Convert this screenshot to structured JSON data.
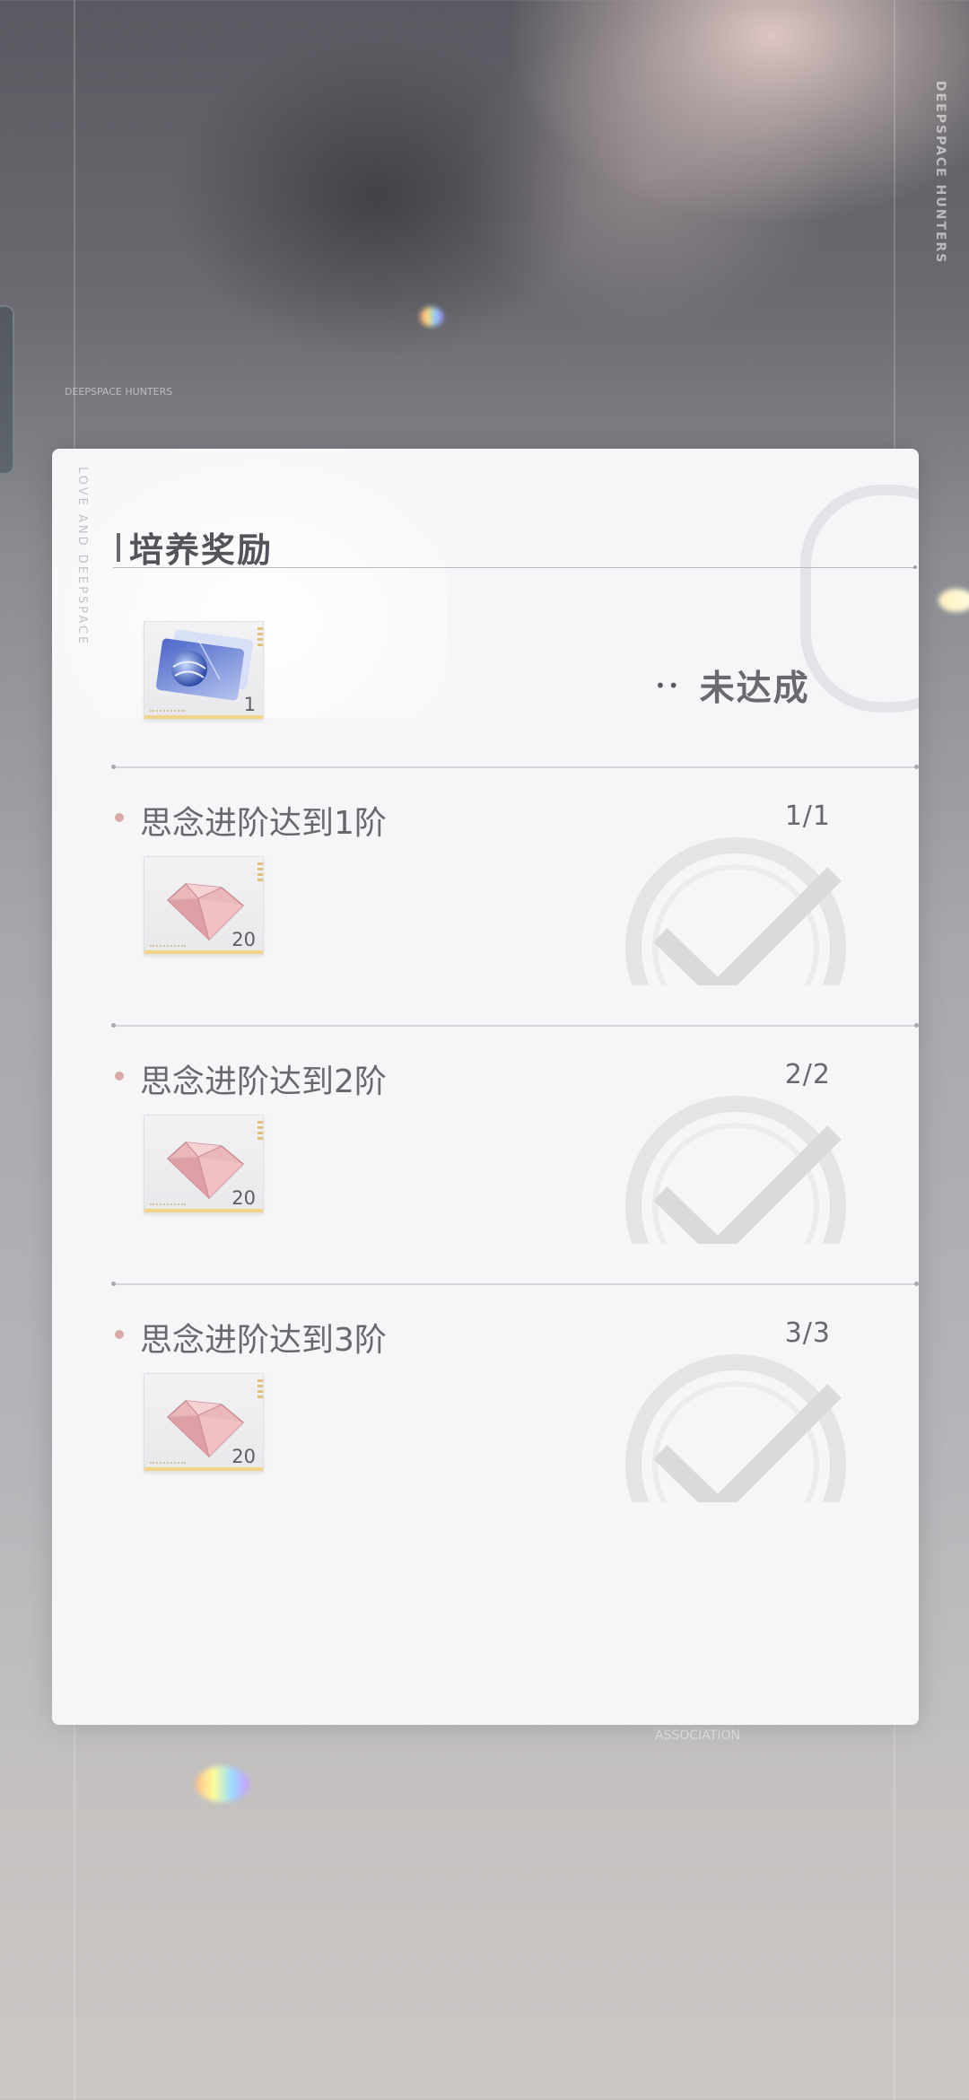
{
  "background": {
    "brand_vertical": "DEEPSPACE HUNTERS",
    "panel_side_text": "LOVE AND DEEPSPACE",
    "tiny_top": "DEEPSPACE HUNTERS",
    "tiny_bottom": "ASSOCIATION"
  },
  "panel": {
    "title": "培养奖励",
    "main_reward": {
      "icon": "card-pass-icon",
      "count": "1"
    },
    "status_icon": "••",
    "status_label": "未达成"
  },
  "tasks": [
    {
      "label": "思念进阶达到1阶",
      "progress": "1/1",
      "reward_icon": "pink-diamond-icon",
      "reward_count": "20",
      "state": "completed"
    },
    {
      "label": "思念进阶达到2阶",
      "progress": "2/2",
      "reward_icon": "pink-diamond-icon",
      "reward_count": "20",
      "state": "completed"
    },
    {
      "label": "思念进阶达到3阶",
      "progress": "3/3",
      "reward_icon": "pink-diamond-icon",
      "reward_count": "20",
      "state": "completed"
    }
  ],
  "colors": {
    "accent_gold": "#f1d488",
    "bullet_pink": "#d9a9a5",
    "panel_bg": "#f6f6f8"
  }
}
